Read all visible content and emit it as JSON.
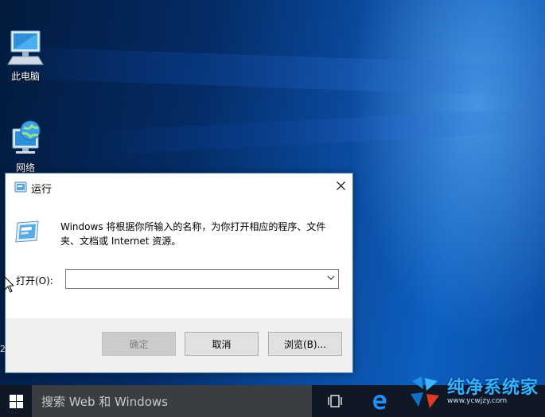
{
  "desktop": {
    "icons": [
      {
        "label": "此电脑",
        "icon": "computer-icon"
      },
      {
        "label": "网络",
        "icon": "network-globe-icon"
      }
    ],
    "edge_char": "2"
  },
  "dialog": {
    "title": "运行",
    "description": "Windows 将根据你所输入的名称，为你打开相应的程序、文件夹、文档或 Internet 资源。",
    "open_label": "打开(O):",
    "input_value": "",
    "buttons": {
      "ok": "确定",
      "cancel": "取消",
      "browse": "浏览(B)..."
    }
  },
  "taskbar": {
    "search_placeholder": "搜索 Web 和 Windows",
    "icons": [
      "windows-start-icon",
      "task-view-icon",
      "edge-browser-icon"
    ]
  },
  "watermark": {
    "title": "纯净系统家",
    "url": "www.ycwjzy.com"
  },
  "colors": {
    "accent": "#3c7fb1",
    "taskbar": "#101826",
    "search_box": "#3a3d42",
    "watermark": "#35b3ff"
  }
}
